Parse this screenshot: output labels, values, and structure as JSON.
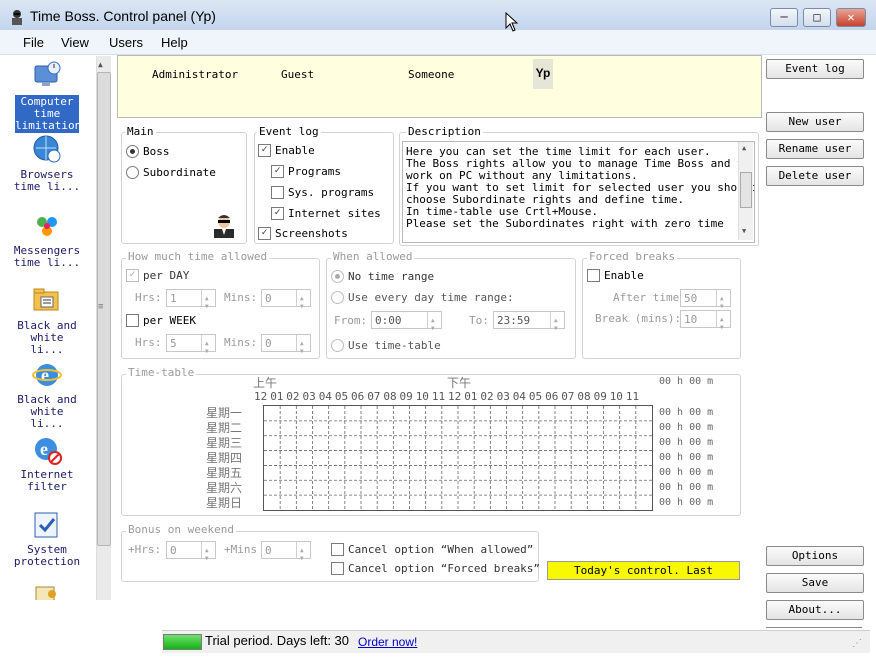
{
  "window": {
    "title": "Time Boss. Control panel (Yp)"
  },
  "menu": [
    "File",
    "View",
    "Users",
    "Help"
  ],
  "sidebar": {
    "items": [
      {
        "label": "Computer time limitation",
        "lines": [
          "Computer",
          "time",
          "limitation"
        ],
        "icon": "monitor-clock-icon",
        "selected": true
      },
      {
        "label": "Browsers time li...",
        "lines": [
          "Browsers",
          "time li..."
        ],
        "icon": "globe-clock-icon"
      },
      {
        "label": "Messengers time li...",
        "lines": [
          "Messengers",
          "time li..."
        ],
        "icon": "messenger-people-icon"
      },
      {
        "label": "Black and white li...",
        "lines": [
          "Black and",
          "white li..."
        ],
        "icon": "folder-list-icon"
      },
      {
        "label": "Black and white li...",
        "lines": [
          "Black and",
          "white li..."
        ],
        "icon": "ie-logo-icon"
      },
      {
        "label": "Internet filter",
        "lines": [
          "Internet",
          "filter"
        ],
        "icon": "ie-block-icon"
      },
      {
        "label": "System protection",
        "lines": [
          "System",
          "protection"
        ],
        "icon": "shield-check-icon"
      }
    ]
  },
  "users": [
    "Administrator",
    "Guest",
    "Someone",
    "Yp"
  ],
  "main_group": {
    "title": "Main",
    "boss": "Boss",
    "subordinate": "Subordinate",
    "selected": "Boss"
  },
  "event_log": {
    "title": "Event log",
    "enable": "Enable",
    "programs": "Programs",
    "sys_programs": "Sys. programs",
    "internet_sites": "Internet sites",
    "screenshots": "Screenshots"
  },
  "description": {
    "title": "Description",
    "lines": [
      "Here you can set the time limit for each user.",
      "The Boss rights allow you to manage Time Boss and to",
      "work on PC without any limitations.",
      "If you want to set limit for selected user you should",
      "choose Subordinate rights and define time.",
      "In time-table use Crtl+Mouse.",
      "Please set the Subordinates right with zero time"
    ]
  },
  "time_allowed": {
    "title": "How much time allowed",
    "per_day": "per DAY",
    "per_week": "per WEEK",
    "hrs": "Hrs:",
    "mins": "Mins:",
    "day_hrs": "1",
    "day_mins": "0",
    "week_hrs": "5",
    "week_mins": "0"
  },
  "when_allowed": {
    "title": "When allowed",
    "no_range": "No time range",
    "every_day": "Use every day time range:",
    "from_label": "From:",
    "from": "0:00",
    "to_label": "To:",
    "to": "23:59",
    "timetable": "Use time-table"
  },
  "forced_breaks": {
    "title": "Forced breaks",
    "enable": "Enable",
    "after_time": "After time",
    "after_value": "50",
    "break_mins": "Break (mins):",
    "break_value": "10"
  },
  "timetable": {
    "title": "Time-table",
    "am": "上午",
    "pm": "下午",
    "hours": [
      "12",
      "01",
      "02",
      "03",
      "04",
      "05",
      "06",
      "07",
      "08",
      "09",
      "10",
      "11",
      "12",
      "01",
      "02",
      "03",
      "04",
      "05",
      "06",
      "07",
      "08",
      "09",
      "10",
      "11"
    ],
    "days": [
      "星期一",
      "星期二",
      "星期三",
      "星期四",
      "星期五",
      "星期六",
      "星期日"
    ],
    "total": "00 h 00 m",
    "day_totals": [
      "00 h 00 m",
      "00 h 00 m",
      "00 h 00 m",
      "00 h 00 m",
      "00 h 00 m",
      "00 h 00 m",
      "00 h 00 m"
    ]
  },
  "bonus": {
    "title": "Bonus on weekend",
    "hrs": "+Hrs:",
    "hrs_value": "0",
    "mins": "+Mins",
    "mins_value": "0",
    "cancel_when": "Cancel option “When allowed”",
    "cancel_breaks": "Cancel option “Forced breaks”"
  },
  "today_control": "Today's control. Last",
  "right_buttons": {
    "event_log": "Event log",
    "new_user": "New user",
    "rename_user": "Rename user",
    "delete_user": "Delete user",
    "options": "Options",
    "save": "Save",
    "about": "About..."
  },
  "status": {
    "trial": "Trial period. Days left: 30",
    "order": "Order now!",
    "progress": 1.0
  }
}
